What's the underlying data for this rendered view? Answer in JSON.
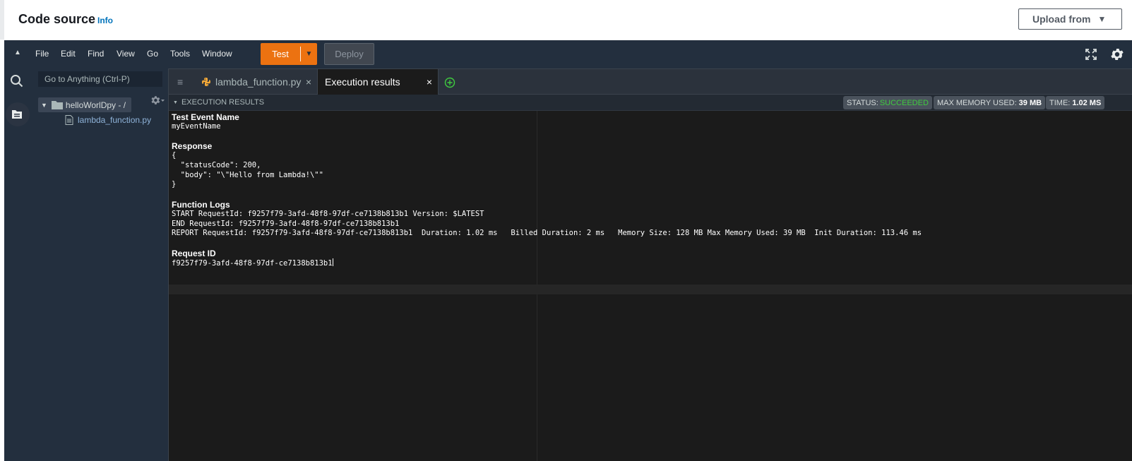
{
  "header": {
    "title": "Code source",
    "info_link": "Info",
    "upload_button": "Upload from"
  },
  "menu": {
    "items": [
      "File",
      "Edit",
      "Find",
      "View",
      "Go",
      "Tools",
      "Window"
    ],
    "test_button": "Test",
    "deploy_button": "Deploy"
  },
  "sidebar": {
    "goto_placeholder": "Go to Anything (Ctrl-P)",
    "folder": "helloWorlDpy - /",
    "file": "lambda_function.py"
  },
  "tabs": {
    "file_tab": "lambda_function.py",
    "active_tab": "Execution results",
    "close_glyph": "×"
  },
  "results": {
    "section_title": "EXECUTION RESULTS",
    "status_label": "STATUS:",
    "status_value": "SUCCEEDED",
    "memory_label": "MAX MEMORY USED:",
    "memory_value": "39 MB",
    "time_label": "TIME:",
    "time_value": "1.02 MS",
    "test_event_heading": "Test Event Name",
    "test_event_value": "myEventName",
    "response_heading": "Response",
    "response_lines": [
      "{",
      "  \"statusCode\": 200,",
      "  \"body\": \"\\\"Hello from Lambda!\\\"\"",
      "}"
    ],
    "logs_heading": "Function Logs",
    "log_lines": [
      "START RequestId: f9257f79-3afd-48f8-97df-ce7138b813b1 Version: $LATEST",
      "END RequestId: f9257f79-3afd-48f8-97df-ce7138b813b1",
      "REPORT RequestId: f9257f79-3afd-48f8-97df-ce7138b813b1  Duration: 1.02 ms   Billed Duration: 2 ms   Memory Size: 128 MB Max Memory Used: 39 MB  Init Duration: 113.46 ms"
    ],
    "request_id_heading": "Request ID",
    "request_id_value": "f9257f79-3afd-48f8-97df-ce7138b813b1"
  },
  "colors": {
    "accent": "#ec7211",
    "success": "#3fcc3f",
    "link": "#0073bb"
  }
}
